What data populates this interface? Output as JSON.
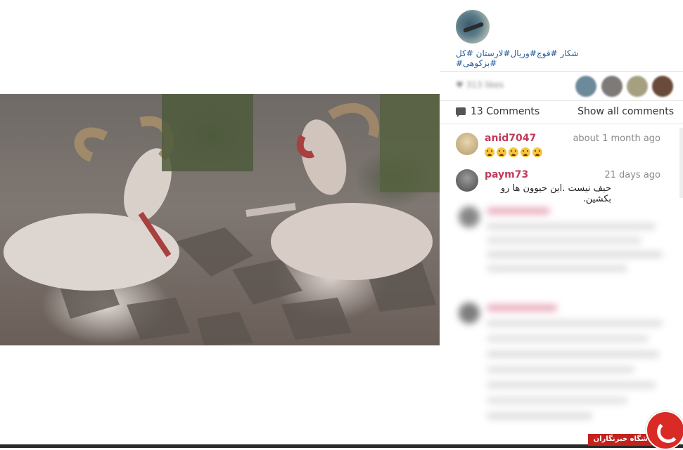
{
  "post": {
    "image_alt_icon": "post-photo",
    "hashtags_text": "شکار #قوچ#وریال#لارستان #کل #بزکوهی#",
    "likes_text": "313 likes",
    "comments_count": "13 Comments",
    "show_all_label": "Show all comments"
  },
  "comments": [
    {
      "user": "anid7047",
      "time": "about 1 month ago",
      "emoji_count": 5
    },
    {
      "user": "paym73",
      "time": "21 days ago",
      "text": "حیف نیست .این حیوون ها رو بکشین."
    }
  ],
  "watermark": {
    "text": "باشگاه خبرنگاران",
    "color": "#c3221f"
  }
}
